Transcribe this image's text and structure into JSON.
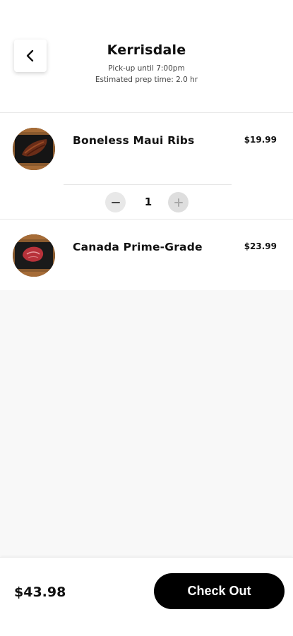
{
  "header": {
    "store_name": "Kerrisdale",
    "pickup_text": "Pick-up until 7:00pm",
    "prep_text": "Estimated prep time: 2.0 hr",
    "back_icon": "chevron-left-icon"
  },
  "cart": {
    "items": [
      {
        "name": "Boneless Maui Ribs",
        "price": "$19.99",
        "quantity": "1",
        "image_icon": "ribs-thumbnail"
      },
      {
        "name": "Canada Prime-Grade",
        "price": "$23.99",
        "image_icon": "steak-thumbnail"
      }
    ]
  },
  "footer": {
    "total": "$43.98",
    "checkout_label": "Check Out"
  },
  "colors": {
    "accent": "#000000",
    "background_empty": "#f8f8f8",
    "stepper_bg": "#e8e8e8"
  }
}
